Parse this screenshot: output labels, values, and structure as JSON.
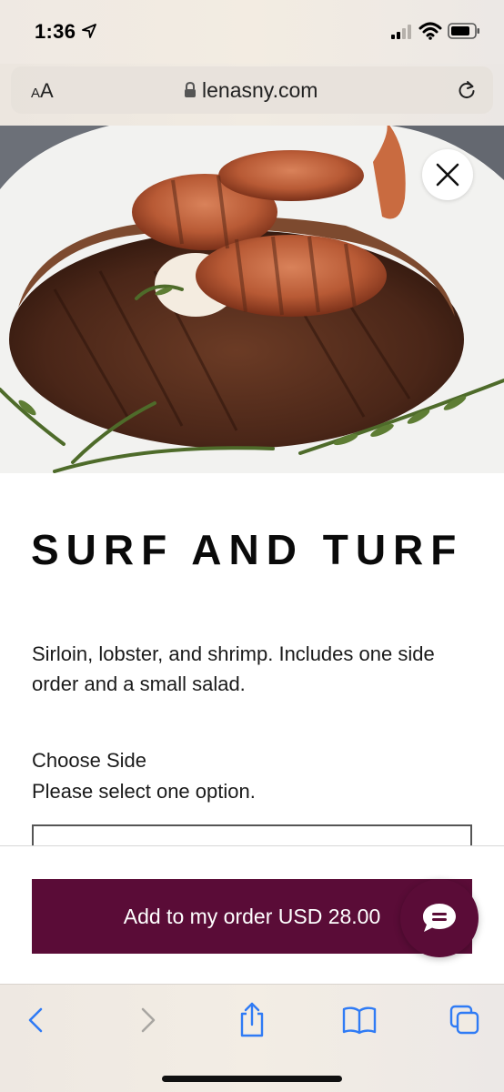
{
  "status_bar": {
    "time": "1:36",
    "icons": [
      "location-arrow-icon",
      "cellular-signal-icon",
      "wifi-icon",
      "battery-icon"
    ]
  },
  "browser": {
    "text_size_button": "AA",
    "url": "lenasny.com",
    "icons": [
      "lock-icon",
      "reload-icon"
    ]
  },
  "item": {
    "title": "SURF AND TURF",
    "description": "Sirloin, lobster, and shrimp. Includes one side order and a small salad.",
    "options": {
      "label": "Choose Side",
      "help_text": "Please select one option."
    }
  },
  "order": {
    "add_button_label": "Add to my order USD 28.00"
  },
  "toolbar": {
    "icons": [
      "back-icon",
      "forward-icon",
      "share-icon",
      "bookmarks-icon",
      "tabs-icon"
    ]
  },
  "colors": {
    "accent": "#5a0c37",
    "ios_blue": "#2f7bf5"
  }
}
